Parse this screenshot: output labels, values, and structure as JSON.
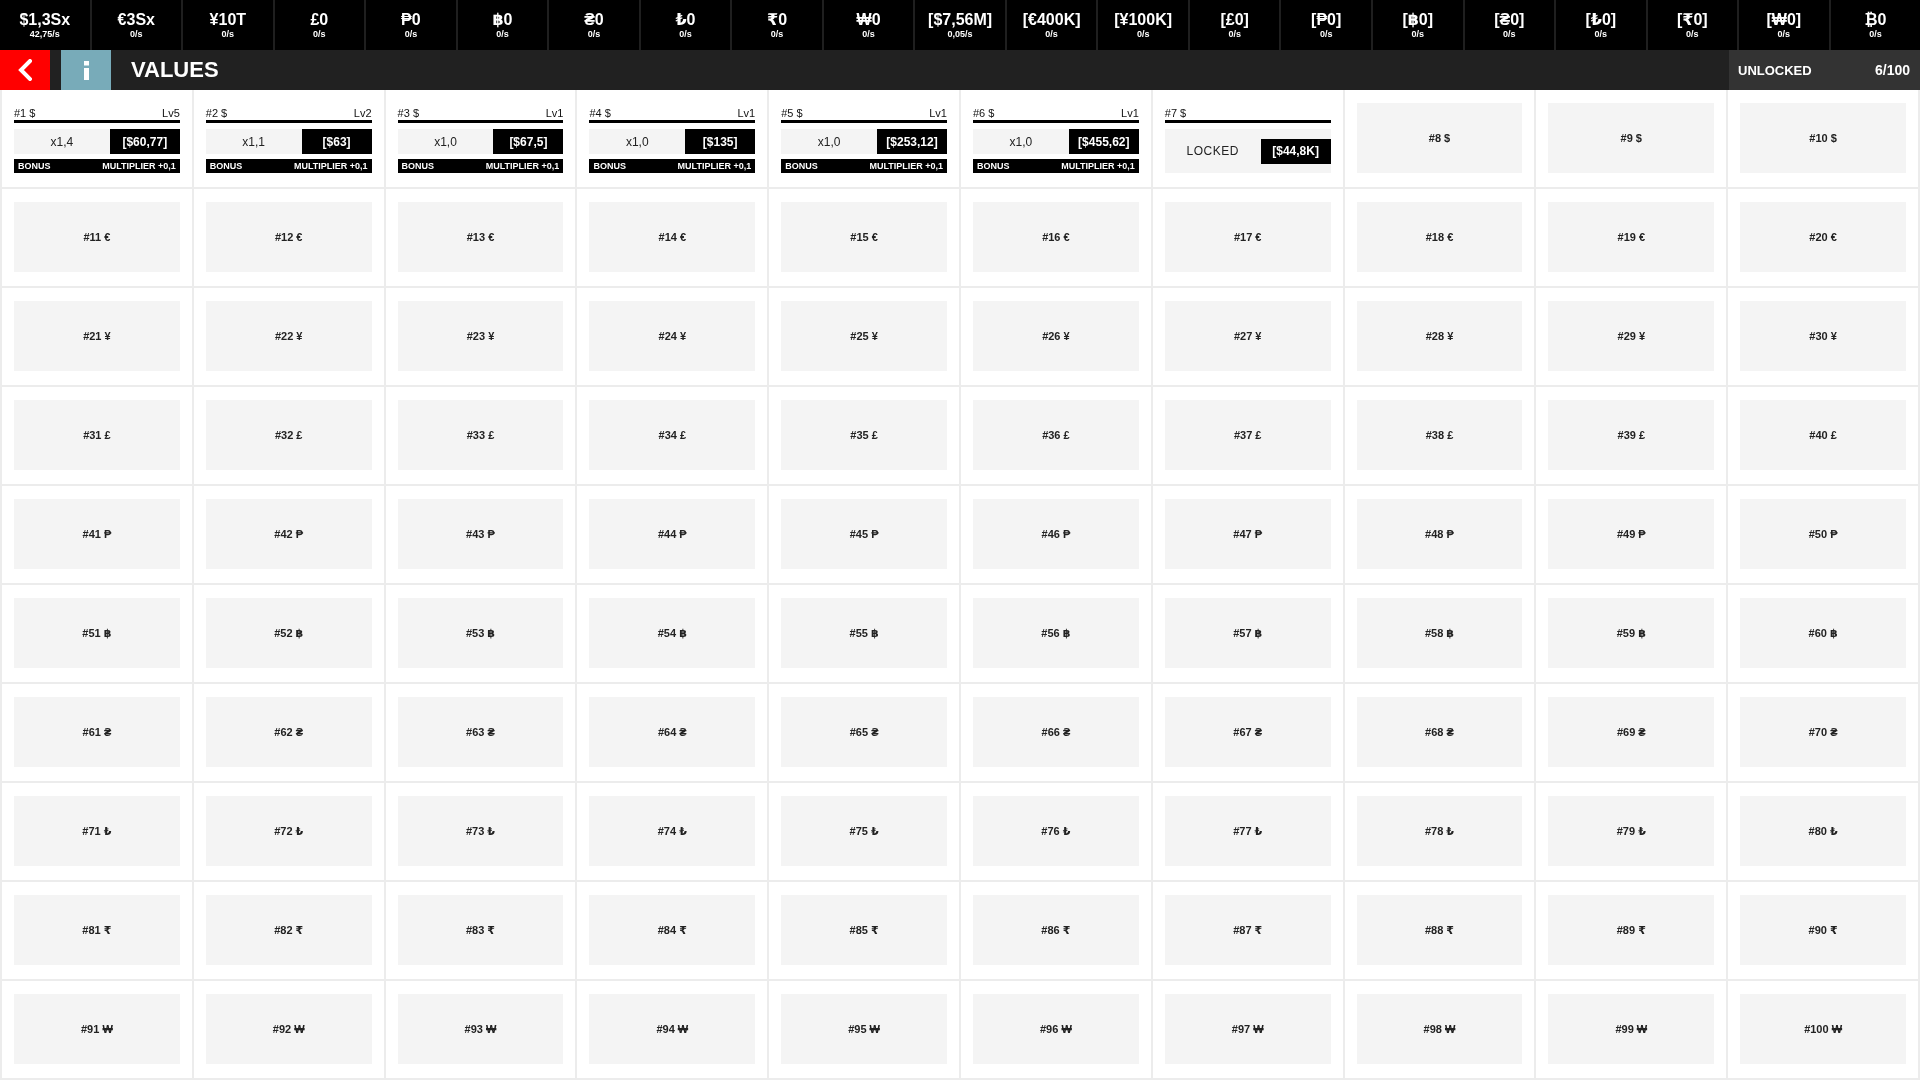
{
  "currencies": [
    {
      "amount": "$1,3Sx",
      "rate": "42,75/s"
    },
    {
      "amount": "€3Sx",
      "rate": "0/s"
    },
    {
      "amount": "¥10T",
      "rate": "0/s"
    },
    {
      "amount": "£0",
      "rate": "0/s"
    },
    {
      "amount": "₱0",
      "rate": "0/s"
    },
    {
      "amount": "฿0",
      "rate": "0/s"
    },
    {
      "amount": "₴0",
      "rate": "0/s"
    },
    {
      "amount": "₺0",
      "rate": "0/s"
    },
    {
      "amount": "₹0",
      "rate": "0/s"
    },
    {
      "amount": "₩0",
      "rate": "0/s"
    },
    {
      "amount": "[$7,56M]",
      "rate": "0,05/s"
    },
    {
      "amount": "[€400K]",
      "rate": "0/s"
    },
    {
      "amount": "[¥100K]",
      "rate": "0/s"
    },
    {
      "amount": "[£0]",
      "rate": "0/s"
    },
    {
      "amount": "[₱0]",
      "rate": "0/s"
    },
    {
      "amount": "[฿0]",
      "rate": "0/s"
    },
    {
      "amount": "[₴0]",
      "rate": "0/s"
    },
    {
      "amount": "[₺0]",
      "rate": "0/s"
    },
    {
      "amount": "[₹0]",
      "rate": "0/s"
    },
    {
      "amount": "[₩0]",
      "rate": "0/s"
    },
    {
      "amount": "₿0",
      "rate": "0/s"
    }
  ],
  "header": {
    "title": "VALUES",
    "unlocked_label": "UNLOCKED",
    "unlocked_count": "6/100"
  },
  "values": [
    {
      "kind": "unlocked",
      "label": "#1 $",
      "level_label": "Lv5",
      "multiplier": "x1,4",
      "price": "[$60,77]",
      "bonus": "BONUS",
      "bonus_effect": "MULTIPLIER +0,1"
    },
    {
      "kind": "unlocked",
      "label": "#2 $",
      "level_label": "Lv2",
      "multiplier": "x1,1",
      "price": "[$63]",
      "bonus": "BONUS",
      "bonus_effect": "MULTIPLIER +0,1"
    },
    {
      "kind": "unlocked",
      "label": "#3 $",
      "level_label": "Lv1",
      "multiplier": "x1,0",
      "price": "[$67,5]",
      "bonus": "BONUS",
      "bonus_effect": "MULTIPLIER +0,1"
    },
    {
      "kind": "unlocked",
      "label": "#4 $",
      "level_label": "Lv1",
      "multiplier": "x1,0",
      "price": "[$135]",
      "bonus": "BONUS",
      "bonus_effect": "MULTIPLIER +0,1"
    },
    {
      "kind": "unlocked",
      "label": "#5 $",
      "level_label": "Lv1",
      "multiplier": "x1,0",
      "price": "[$253,12]",
      "bonus": "BONUS",
      "bonus_effect": "MULTIPLIER +0,1"
    },
    {
      "kind": "unlocked",
      "label": "#6 $",
      "level_label": "Lv1",
      "multiplier": "x1,0",
      "price": "[$455,62]",
      "bonus": "BONUS",
      "bonus_effect": "MULTIPLIER +0,1"
    },
    {
      "kind": "next",
      "label": "#7 $",
      "status": "LOCKED",
      "price": "[$44,8K]"
    },
    {
      "kind": "locked",
      "label": "#8 $"
    },
    {
      "kind": "locked",
      "label": "#9 $"
    },
    {
      "kind": "locked",
      "label": "#10 $"
    },
    {
      "kind": "locked",
      "label": "#11 €"
    },
    {
      "kind": "locked",
      "label": "#12 €"
    },
    {
      "kind": "locked",
      "label": "#13 €"
    },
    {
      "kind": "locked",
      "label": "#14 €"
    },
    {
      "kind": "locked",
      "label": "#15 €"
    },
    {
      "kind": "locked",
      "label": "#16 €"
    },
    {
      "kind": "locked",
      "label": "#17 €"
    },
    {
      "kind": "locked",
      "label": "#18 €"
    },
    {
      "kind": "locked",
      "label": "#19 €"
    },
    {
      "kind": "locked",
      "label": "#20 €"
    },
    {
      "kind": "locked",
      "label": "#21 ¥"
    },
    {
      "kind": "locked",
      "label": "#22 ¥"
    },
    {
      "kind": "locked",
      "label": "#23 ¥"
    },
    {
      "kind": "locked",
      "label": "#24 ¥"
    },
    {
      "kind": "locked",
      "label": "#25 ¥"
    },
    {
      "kind": "locked",
      "label": "#26 ¥"
    },
    {
      "kind": "locked",
      "label": "#27 ¥"
    },
    {
      "kind": "locked",
      "label": "#28 ¥"
    },
    {
      "kind": "locked",
      "label": "#29 ¥"
    },
    {
      "kind": "locked",
      "label": "#30 ¥"
    },
    {
      "kind": "locked",
      "label": "#31 £"
    },
    {
      "kind": "locked",
      "label": "#32 £"
    },
    {
      "kind": "locked",
      "label": "#33 £"
    },
    {
      "kind": "locked",
      "label": "#34 £"
    },
    {
      "kind": "locked",
      "label": "#35 £"
    },
    {
      "kind": "locked",
      "label": "#36 £"
    },
    {
      "kind": "locked",
      "label": "#37 £"
    },
    {
      "kind": "locked",
      "label": "#38 £"
    },
    {
      "kind": "locked",
      "label": "#39 £"
    },
    {
      "kind": "locked",
      "label": "#40 £"
    },
    {
      "kind": "locked",
      "label": "#41 ₱"
    },
    {
      "kind": "locked",
      "label": "#42 ₱"
    },
    {
      "kind": "locked",
      "label": "#43 ₱"
    },
    {
      "kind": "locked",
      "label": "#44 ₱"
    },
    {
      "kind": "locked",
      "label": "#45 ₱"
    },
    {
      "kind": "locked",
      "label": "#46 ₱"
    },
    {
      "kind": "locked",
      "label": "#47 ₱"
    },
    {
      "kind": "locked",
      "label": "#48 ₱"
    },
    {
      "kind": "locked",
      "label": "#49 ₱"
    },
    {
      "kind": "locked",
      "label": "#50 ₱"
    },
    {
      "kind": "locked",
      "label": "#51 ฿"
    },
    {
      "kind": "locked",
      "label": "#52 ฿"
    },
    {
      "kind": "locked",
      "label": "#53 ฿"
    },
    {
      "kind": "locked",
      "label": "#54 ฿"
    },
    {
      "kind": "locked",
      "label": "#55 ฿"
    },
    {
      "kind": "locked",
      "label": "#56 ฿"
    },
    {
      "kind": "locked",
      "label": "#57 ฿"
    },
    {
      "kind": "locked",
      "label": "#58 ฿"
    },
    {
      "kind": "locked",
      "label": "#59 ฿"
    },
    {
      "kind": "locked",
      "label": "#60 ฿"
    },
    {
      "kind": "locked",
      "label": "#61 ₴"
    },
    {
      "kind": "locked",
      "label": "#62 ₴"
    },
    {
      "kind": "locked",
      "label": "#63 ₴"
    },
    {
      "kind": "locked",
      "label": "#64 ₴"
    },
    {
      "kind": "locked",
      "label": "#65 ₴"
    },
    {
      "kind": "locked",
      "label": "#66 ₴"
    },
    {
      "kind": "locked",
      "label": "#67 ₴"
    },
    {
      "kind": "locked",
      "label": "#68 ₴"
    },
    {
      "kind": "locked",
      "label": "#69 ₴"
    },
    {
      "kind": "locked",
      "label": "#70 ₴"
    },
    {
      "kind": "locked",
      "label": "#71 ₺"
    },
    {
      "kind": "locked",
      "label": "#72 ₺"
    },
    {
      "kind": "locked",
      "label": "#73 ₺"
    },
    {
      "kind": "locked",
      "label": "#74 ₺"
    },
    {
      "kind": "locked",
      "label": "#75 ₺"
    },
    {
      "kind": "locked",
      "label": "#76 ₺"
    },
    {
      "kind": "locked",
      "label": "#77 ₺"
    },
    {
      "kind": "locked",
      "label": "#78 ₺"
    },
    {
      "kind": "locked",
      "label": "#79 ₺"
    },
    {
      "kind": "locked",
      "label": "#80 ₺"
    },
    {
      "kind": "locked",
      "label": "#81 ₹"
    },
    {
      "kind": "locked",
      "label": "#82 ₹"
    },
    {
      "kind": "locked",
      "label": "#83 ₹"
    },
    {
      "kind": "locked",
      "label": "#84 ₹"
    },
    {
      "kind": "locked",
      "label": "#85 ₹"
    },
    {
      "kind": "locked",
      "label": "#86 ₹"
    },
    {
      "kind": "locked",
      "label": "#87 ₹"
    },
    {
      "kind": "locked",
      "label": "#88 ₹"
    },
    {
      "kind": "locked",
      "label": "#89 ₹"
    },
    {
      "kind": "locked",
      "label": "#90 ₹"
    },
    {
      "kind": "locked",
      "label": "#91 ₩"
    },
    {
      "kind": "locked",
      "label": "#92 ₩"
    },
    {
      "kind": "locked",
      "label": "#93 ₩"
    },
    {
      "kind": "locked",
      "label": "#94 ₩"
    },
    {
      "kind": "locked",
      "label": "#95 ₩"
    },
    {
      "kind": "locked",
      "label": "#96 ₩"
    },
    {
      "kind": "locked",
      "label": "#97 ₩"
    },
    {
      "kind": "locked",
      "label": "#98 ₩"
    },
    {
      "kind": "locked",
      "label": "#99 ₩"
    },
    {
      "kind": "locked",
      "label": "#100 ₩"
    }
  ]
}
